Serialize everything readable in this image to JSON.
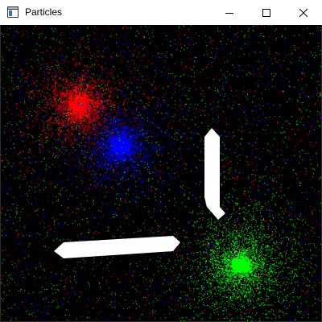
{
  "window": {
    "title": "Particles",
    "minimize_icon": "minimize-icon",
    "maximize_icon": "maximize-icon",
    "close_icon": "close-icon"
  },
  "scene": {
    "background": "#000000",
    "emitters": [
      {
        "name": "red-emitter",
        "color": "#ff0000"
      },
      {
        "name": "blue-emitter",
        "color": "#0000ff"
      },
      {
        "name": "green-emitter",
        "color": "#00ff00"
      }
    ],
    "obstacle_color": "#ffffff"
  }
}
